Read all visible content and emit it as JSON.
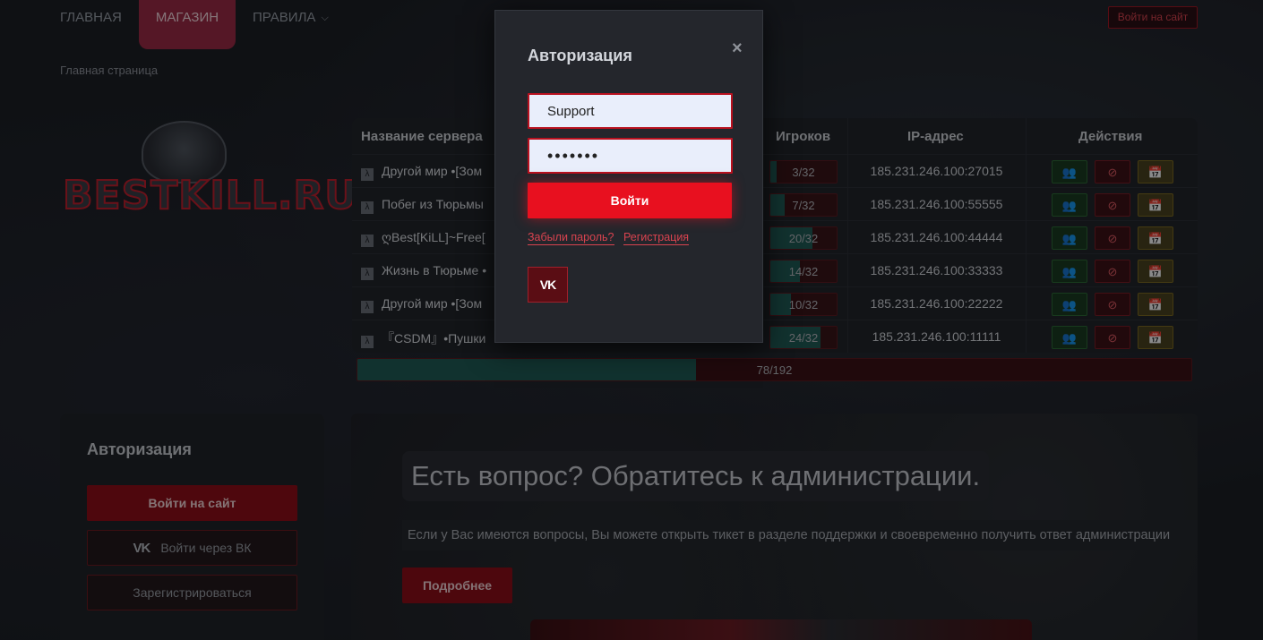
{
  "nav": {
    "items": [
      {
        "label": "ГЛАВНАЯ",
        "active": false
      },
      {
        "label": "МАГАЗИН",
        "active": true
      },
      {
        "label": "ПРАВИЛА",
        "active": false,
        "has_dropdown": true
      }
    ],
    "login_button": "Войти на сайт",
    "breadcrumb": "Главная страница"
  },
  "logo": {
    "text": "BESTKILL.RU"
  },
  "servers": {
    "headers": {
      "name": "Название сервера",
      "players": "Игроков",
      "ip": "IP-адрес",
      "actions": "Действия"
    },
    "rows": [
      {
        "name": "Другой мир •[Зом",
        "players": "3/32",
        "fill": 0.09,
        "ip": "185.231.246.100:27015"
      },
      {
        "name": "Побег из Тюрьмы",
        "players": "7/32",
        "fill": 0.22,
        "ip": "185.231.246.100:55555"
      },
      {
        "name": "ღBest[KiLL]~Free[",
        "players": "20/32",
        "fill": 0.63,
        "ip": "185.231.246.100:44444"
      },
      {
        "name": "Жизнь в Тюрьме •",
        "players": "14/32",
        "fill": 0.44,
        "ip": "185.231.246.100:33333"
      },
      {
        "name": "Другой мир •[Зом",
        "players": "10/32",
        "fill": 0.31,
        "ip": "185.231.246.100:22222"
      },
      {
        "name": "『CSDM』•Пушки",
        "players": "24/32",
        "fill": 0.75,
        "ip": "185.231.246.100:11111"
      }
    ],
    "total": {
      "label": "78/192",
      "fill": 0.406
    }
  },
  "auth_panel": {
    "title": "Авторизация",
    "site_button": "Войти на сайт",
    "vk_button": "Войти через ВК",
    "register_button": "Зарегистрироваться"
  },
  "banner": {
    "title": "Есть вопрос? Обратитесь к администрации.",
    "text": "Если у Вас имеются вопросы, Вы можете открыть тикет в разделе поддержки и своевременно получить ответ администрации",
    "button": "Подробнее"
  },
  "modal": {
    "title": "Авторизация",
    "close": "×",
    "login_value": "Support",
    "password_value": "•••••••",
    "submit": "Войти",
    "forgot": "Забыли пароль?",
    "register": "Регистрация",
    "vk_label": "VK"
  },
  "colors": {
    "accent_red": "#e8101f",
    "dark_red": "#8e0d19",
    "player_fill": "#1f5b56",
    "background": "#1c1f25"
  },
  "icons": {
    "server_row": "hlds-icon",
    "action_players": "users-icon",
    "action_ban": "ban-icon",
    "action_calendar": "calendar-icon"
  }
}
